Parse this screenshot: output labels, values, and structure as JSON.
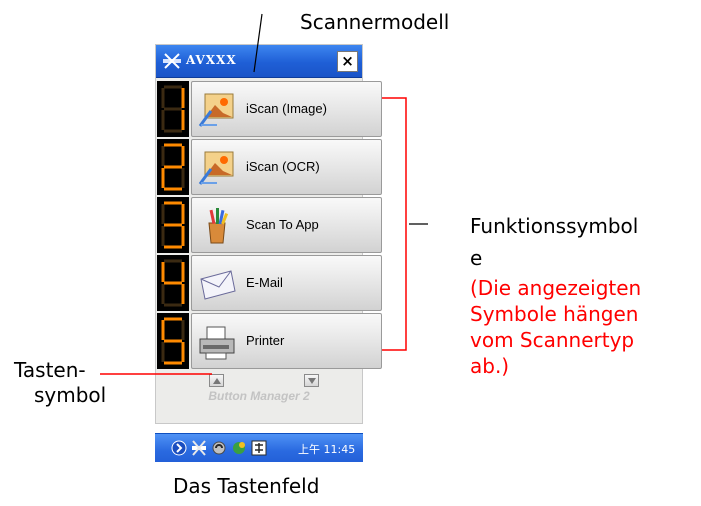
{
  "callouts": {
    "scanner_model": "Scannermodell",
    "function_symbols_line1": "Funktionssymbol",
    "function_symbols_line2": "e",
    "note_line1": "(Die angezeigten",
    "note_line2": "Symbole hängen",
    "note_line3": "vom Scannertyp",
    "note_line4": "ab.)",
    "button_symbol_line1": "Tasten-",
    "button_symbol_line2": "symbol",
    "caption": "Das Tastenfeld"
  },
  "window": {
    "title": "AVXXX",
    "close_label": "×"
  },
  "buttons": [
    {
      "number": "1",
      "label": "iScan (Image)",
      "icon": "image-scan-icon"
    },
    {
      "number": "2",
      "label": "iScan (OCR)",
      "icon": "ocr-scan-icon"
    },
    {
      "number": "3",
      "label": "Scan To App",
      "icon": "app-icon"
    },
    {
      "number": "4",
      "label": "E-Mail",
      "icon": "envelope-icon"
    },
    {
      "number": "5",
      "label": "Printer",
      "icon": "printer-icon"
    }
  ],
  "navigation": {
    "up_icon": "arrow-up-icon",
    "down_icon": "arrow-down-icon"
  },
  "brand": "Button Manager 2",
  "taskbar": {
    "clock": "上午 11:45"
  },
  "colors": {
    "note_red": "#ff0000",
    "digit_orange": "#ff8a00",
    "titlebar_blue": "#1f5fd6",
    "taskbar_blue": "#2a6ae0"
  }
}
